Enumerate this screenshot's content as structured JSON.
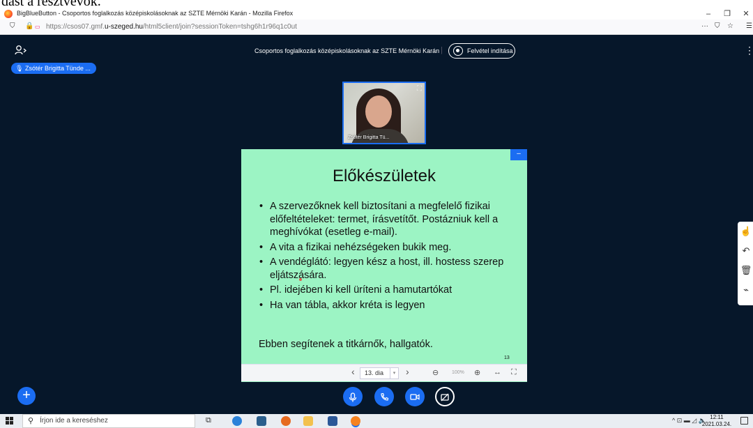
{
  "caption": "dást a résztvevők.",
  "window": {
    "title": "BigBlueButton - Csoportos foglalkozás középiskolásoknak az SZTE Mérnöki Karán - Mozilla Firefox",
    "controls": [
      "–",
      "❐",
      "✕"
    ]
  },
  "urlbar": {
    "url_prefix": "https://csos07.gmf.",
    "url_domain": "u-szeged.hu",
    "url_suffix": "/html5client/join?sessionToken=tshg6h1r96q1c0ut",
    "right_icons": [
      "···",
      "⛉",
      "☆"
    ],
    "menu_icon": "☰"
  },
  "meeting": {
    "title": "Csoportos foglalkozás középiskolásoknak az SZTE Mérnöki Karán",
    "separator": "|",
    "record_label": "Felvétel indítása",
    "speaker": "Zsótér Brigitta Tünde ...",
    "more_icon": "⋮",
    "users_icon": "user-list-icon"
  },
  "webcam": {
    "name": "Zsótér Brigitta Tü..."
  },
  "slide": {
    "title": "Előkészületek",
    "bullets": [
      "A szervezőknek kell biztosítani a megfelelő fizikai előfeltételeket: termet, írásvetítőt. Postázniuk kell a meghívókat (esetleg e-mail).",
      "A vita a fizikai nehézségeken bukik meg.",
      "A vendéglátó: legyen kész a host, ill. hostess szerep eljátszására.",
      "Pl. idejében ki kell üríteni a hamutartókat",
      "Ha van tábla, akkor kréta is legyen"
    ],
    "footer": "Ebben segítenek a titkárnők, hallgatók.",
    "number": "13",
    "minimize_label": "–"
  },
  "presentation_toolbar": {
    "prev": "‹",
    "current_slide": "13. dia",
    "next": "›",
    "zoom_out": "⊖",
    "zoom_level": "100%",
    "zoom_in": "⊕",
    "fit_width": "↔",
    "fullscreen": "⛶"
  },
  "whiteboard_tools": [
    "hand-tool",
    "undo",
    "clear",
    "multi-user"
  ],
  "actions": {
    "plus": "+",
    "mic": "🎙",
    "phone": "✆",
    "camera": "▭",
    "screenshare": "⊘"
  },
  "taskbar": {
    "search_placeholder": "Írjon ide a kereséshez",
    "time": "12:11",
    "date": "2021.03.24.",
    "tray": "^ ⊡ ▬ ◿ 🔈"
  }
}
